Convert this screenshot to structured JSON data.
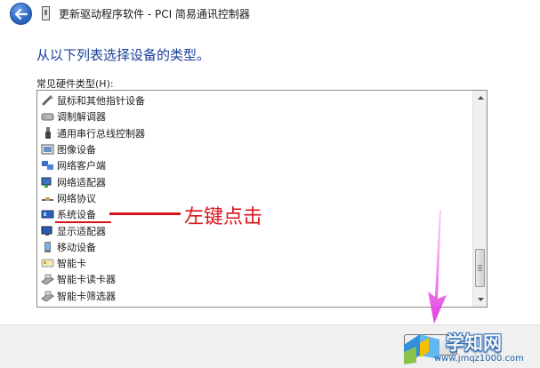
{
  "window": {
    "title": "更新驱动程序软件 - PCI 简易通讯控制器"
  },
  "page": {
    "heading": "从以下列表选择设备的类型。",
    "list_label": "常见硬件类型(H):"
  },
  "hardware_types": [
    {
      "label": "鼠标和其他指针设备",
      "icon": "mouse-icon"
    },
    {
      "label": "调制解调器",
      "icon": "modem-icon"
    },
    {
      "label": "通用串行总线控制器",
      "icon": "usb-icon"
    },
    {
      "label": "图像设备",
      "icon": "camera-icon"
    },
    {
      "label": "网络客户端",
      "icon": "network-client-icon"
    },
    {
      "label": "网络适配器",
      "icon": "network-adapter-icon"
    },
    {
      "label": "网络协议",
      "icon": "network-protocol-icon"
    },
    {
      "label": "系统设备",
      "icon": "system-device-icon"
    },
    {
      "label": "显示适配器",
      "icon": "display-adapter-icon"
    },
    {
      "label": "移动设备",
      "icon": "mobile-device-icon"
    },
    {
      "label": "智能卡",
      "icon": "smart-card-icon"
    },
    {
      "label": "智能卡读卡器",
      "icon": "smart-card-reader-icon"
    },
    {
      "label": "智能卡筛选器",
      "icon": "smart-card-filter-icon"
    }
  ],
  "annotation": {
    "text": "左键点击",
    "color": "#d8141b"
  },
  "watermark": {
    "name": "学知网",
    "url": "www.jmqz1000.com"
  },
  "colors": {
    "heading": "#1a3e9a",
    "arrow": "#e23be0",
    "footer": "#f0f0f0"
  }
}
